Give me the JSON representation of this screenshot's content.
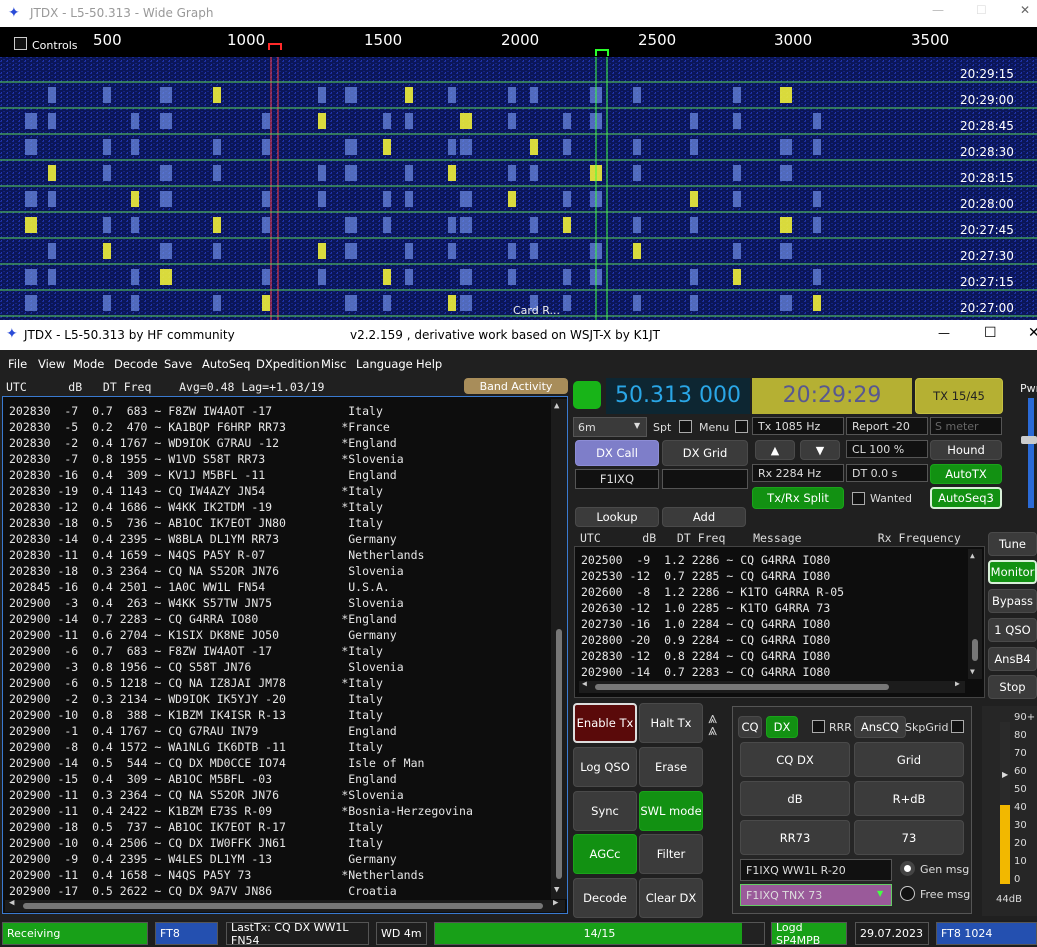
{
  "wide": {
    "title": "JTDX  - L5-50.313  -  Wide Graph",
    "controls": "Controls",
    "ticks": [
      "500",
      "1000",
      "1500",
      "2000",
      "2500",
      "3000",
      "3500"
    ],
    "times": [
      "20:29:15",
      "20:29:00",
      "20:28:45",
      "20:28:30",
      "20:28:15",
      "20:28:00",
      "20:27:45",
      "20:27:30",
      "20:27:15",
      "20:27:00"
    ],
    "card": "Card R..."
  },
  "main": {
    "title": "JTDX  - L5-50.313   by HF community",
    "subtitle": "v2.2.159 , derivative work based on WSJT-X by K1JT"
  },
  "menu": [
    "File",
    "View",
    "Mode",
    "Decode",
    "Save",
    "AutoSeq",
    "DXpedition",
    "Misc",
    "Language",
    "Help"
  ],
  "band_header": "UTC      dB   DT Freq    Avg=0.48 Lag=+1.03/19",
  "band_activity": "Band Activity",
  "band_rows": [
    "202830  -7  0.7  683 ~ F8ZW IW4AOT -17           Italy",
    "202830  -5  0.2  470 ~ KA1BQP F6HRP RR73        *France",
    "202830  -2  0.4 1767 ~ WD9IOK G7RAU -12         *England",
    "202830  -7  0.8 1955 ~ W1VD S58T RR73           *Slovenia",
    "202830 -16  0.4  309 ~ KV1J M5BFL -11            England",
    "202830 -19  0.4 1143 ~ CQ IW4AZY JN54           *Italy",
    "202830 -12  0.4 1686 ~ W4KK IK2TDM -19          *Italy",
    "202830 -18  0.5  736 ~ AB1OC IK7EOT JN80         Italy",
    "202830 -14  0.4 2395 ~ W8BLA DL1YM RR73          Germany",
    "202830 -11  0.4 1659 ~ N4QS PA5Y R-07            Netherlands",
    "202830 -18  0.3 2364 ~ CQ NA S52OR JN76          Slovenia",
    "202845 -16  0.4 2501 ~ 1A0C WW1L FN54            U.S.A.",
    "202900  -3  0.4  263 ~ W4KK S57TW JN75           Slovenia",
    "202900 -14  0.7 2283 ~ CQ G4RRA IO80            *England",
    "202900 -11  0.6 2704 ~ K1SIX DK8NE JO50          Germany",
    "202900  -6  0.7  683 ~ F8ZW IW4AOT -17          *Italy",
    "202900  -3  0.8 1956 ~ CQ S58T JN76              Slovenia",
    "202900  -6  0.5 1218 ~ CQ NA IZ8JAI JM78        *Italy",
    "202900  -2  0.3 2134 ~ WD9IOK IK5YJY -20         Italy",
    "202900 -10  0.8  388 ~ K1BZM IK4ISR R-13         Italy",
    "202900  -1  0.4 1767 ~ CQ G7RAU IN79             England",
    "202900  -8  0.4 1572 ~ WA1NLG IK6DTB -11         Italy",
    "202900 -14  0.5  544 ~ CQ DX MD0CCE IO74         Isle of Man",
    "202900 -15  0.4  309 ~ AB1OC M5BFL -03           England",
    "202900 -11  0.3 2364 ~ CQ NA S52OR JN76         *Slovenia",
    "202900 -11  0.4 2422 ~ K1BZM E73S R-09          *Bosnia-Herzegovina",
    "202900 -18  0.5  737 ~ AB1OC IK7EOT R-17         Italy",
    "202900 -10  0.4 2506 ~ CQ DX IW0FFK JN61         Italy",
    "202900  -9  0.4 2395 ~ W4LES DL1YM -13           Germany",
    "202900 -11  0.4 1658 ~ N4QS PA5Y 73             *Netherlands",
    "202900 -17  0.5 2622 ~ CQ DX 9A7V JN86           Croatia"
  ],
  "freq": "50.313 000",
  "clock": "20:29:29",
  "tx1545": "TX 15/45",
  "pwr": "Pwr",
  "band": "6m",
  "spt": "Spt",
  "menu_cb": "Menu",
  "dxcall_btn": "DX Call",
  "dxgrid_btn": "DX Grid",
  "dxcall_val": "F1IXQ",
  "dxgrid_val": "",
  "lookup": "Lookup",
  "add": "Add",
  "tx_hz": "Tx  1085 Hz",
  "rx_hz": "Rx  2284 Hz",
  "up": "▲",
  "down": "▼",
  "txrx": "Tx/Rx Split",
  "report": "Report -20",
  "smeter": "S meter",
  "cl": "CL  100 %",
  "dt": "DT 0.0 s",
  "wanted": "Wanted",
  "hound": "Hound",
  "autotx": "AutoTX",
  "autoseq": "AutoSeq3",
  "rx_header": "UTC      dB   DT Freq    Message           Rx Frequency",
  "rx_rows": [
    "202500  -9  1.2 2286 ~ CQ G4RRA IO80",
    "202530 -12  0.7 2285 ~ CQ G4RRA IO80",
    "202600  -8  1.2 2286 ~ K1TO G4RRA R-05",
    "202630 -12  1.0 2285 ~ K1TO G4RRA 73",
    "202730 -16  1.0 2284 ~ CQ G4RRA IO80",
    "202800 -20  0.9 2284 ~ CQ G4RRA IO80",
    "202830 -12  0.8 2284 ~ CQ G4RRA IO80",
    "202900 -14  0.7 2283 ~ CQ G4RRA IO80"
  ],
  "side": [
    "Tune",
    "Monitor",
    "Bypass",
    "1 QSO",
    "AnsB4",
    "Stop"
  ],
  "left_btns": {
    "enable": "Enable Tx",
    "halt": "Halt Tx",
    "log": "Log QSO",
    "erase": "Erase",
    "sync": "Sync",
    "swl": "SWL mode",
    "agc": "AGCc",
    "filter": "Filter",
    "decode": "Decode",
    "clear": "Clear DX"
  },
  "msg": {
    "cq": "CQ",
    "dx": "DX",
    "rrr": "RRR",
    "anscq": "AnsCQ",
    "skp": "SkpGrid",
    "cqdx": "CQ DX",
    "grid": "Grid",
    "db": "dB",
    "rdb": "R+dB",
    "rr73": "RR73",
    "s73": "73",
    "gen_text": "F1IXQ WW1L R-20",
    "free_text": "F1IXQ TNX 73",
    "gen": "Gen msg",
    "free": "Free msg"
  },
  "meter": {
    "labels": [
      "90+",
      "80",
      "70",
      "60",
      "50",
      "40",
      "30",
      "20",
      "10",
      "0"
    ],
    "db": "44dB",
    "level_db": 44
  },
  "status": {
    "receiving": "Receiving",
    "mode": "FT8",
    "lasttx": "LastTx: CQ DX WW1L FN54",
    "wd": "WD 4m",
    "progress": "14/15",
    "progress_frac": 0.933,
    "logd": "Logd SP4MPB",
    "date": "29.07.2023",
    "ft8": "FT8  1024"
  }
}
